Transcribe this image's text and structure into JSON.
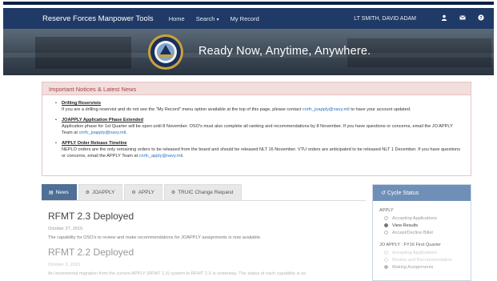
{
  "navbar": {
    "brand": "Reserve Forces Manpower Tools",
    "links": [
      "Home",
      "Search",
      "My Record"
    ],
    "user": "LT SMITH, DAVID ADAM",
    "icons": [
      "user-icon",
      "envelope-icon",
      "help-icon"
    ]
  },
  "hero": {
    "tagline": "Ready Now, Anytime, Anywhere."
  },
  "notices": {
    "heading": "Important Notices & Latest News",
    "items": [
      {
        "title": "Drilling Reservists",
        "text": "If you are a drilling reservist and do not see the \"My Record\" menu option available at the top of this page, please contact",
        "link": "cnrfc_joapply@navy.mil",
        "text_after": " to have your account updated."
      },
      {
        "title": "JOAPPLY Application Phase Extended",
        "text": "Application phase for 1st Quarter will be open until 8 November. OSO's must also complete all ranking and recommendations by 8 November. If you have questions or concerns, email the JO APPLY Team at",
        "link": "cnrfc_joapply@navy.mil",
        "text_after": "."
      },
      {
        "title": "APPLY Order Release Timeline",
        "text": "NEPLO orders are the only remaining orders to be released from the board and should be released NLT 16 November.  VTU orders are anticipated to be released NLT 1 December.  If you have questions or concerns, email the APPLY Team at",
        "link": "cnrfc_apply@navy.mil",
        "text_after": "."
      }
    ]
  },
  "tabs": [
    {
      "label": "News",
      "icon": "newspaper-icon",
      "active": true
    },
    {
      "label": "JOAPPLY",
      "icon": "gear-icon",
      "active": false
    },
    {
      "label": "APPLY",
      "icon": "gear-icon",
      "active": false
    },
    {
      "label": "TRUIC Change Request",
      "icon": "gear-icon",
      "active": false
    }
  ],
  "articles": [
    {
      "title": "RFMT 2.3 Deployed",
      "date": "October 27, 2015",
      "body": "The capability for OSO's to review and make recommendations for JOAPPLY assignments is now available."
    },
    {
      "title": "RFMT 2.2 Deployed",
      "date": "October 2, 2015",
      "body": "An incremental migration from the current APPLY (RFMT 1.0) system to RFMT 2.X is underway. The status of each capability is as"
    }
  ],
  "cycle": {
    "heading": "Cycle Status",
    "sections": [
      {
        "name": "APPLY",
        "rows": [
          {
            "label": "Accepting Applications",
            "checked": false
          },
          {
            "label": "View Results",
            "checked": true
          },
          {
            "label": "Accept/Decline Billet",
            "checked": false
          }
        ]
      },
      {
        "name": "JO APPLY : FY16 First Quarter",
        "rows": [
          {
            "label": "Accepting Applications",
            "checked": false
          },
          {
            "label": "Review and Recommendation",
            "checked": false
          },
          {
            "label": "Making Assignments",
            "checked": true
          }
        ]
      }
    ]
  }
}
